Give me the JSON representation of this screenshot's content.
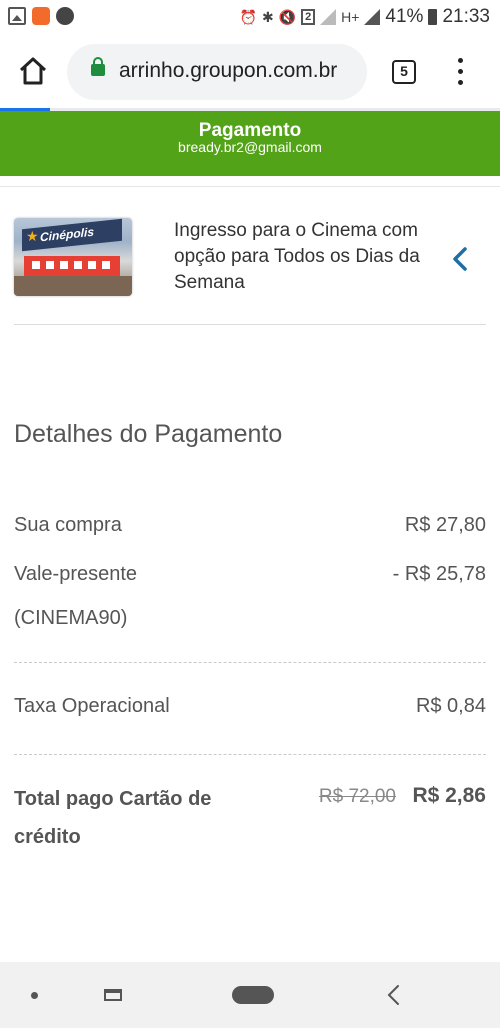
{
  "status_bar": {
    "battery": "41%",
    "time": "21:33",
    "notification_count": "2",
    "network": "H+"
  },
  "browser": {
    "url": "arrinho.groupon.com.br",
    "tab_count": "5"
  },
  "header": {
    "title": "Pagamento",
    "email": "bready.br2@gmail.com"
  },
  "product": {
    "thumb_text": "Cinépolis",
    "title": "Ingresso para o Cinema com opção para Todos os Dias da Semana"
  },
  "payment": {
    "section_title": "Detalhes do Pagamento",
    "purchase_label": "Sua compra",
    "purchase_value": "R$ 27,80",
    "voucher_label": "Vale-presente",
    "voucher_code": "(CINEMA90)",
    "voucher_value": "- R$ 25,78",
    "fee_label": "Taxa Operacional",
    "fee_value": "R$ 0,84",
    "total_label": "Total pago Cartão de crédito",
    "total_old": "R$ 72,00",
    "total_new": "R$ 2,86"
  },
  "colors": {
    "header_green": "#53a318",
    "lock_green": "#1e8e3e",
    "chevron_blue": "#1d6fa5"
  },
  "icons": [
    "gallery-icon",
    "app-icon",
    "spotify-icon",
    "lock-icon",
    "home-icon",
    "tabs-icon",
    "menu-icon",
    "chevron-left-icon"
  ]
}
